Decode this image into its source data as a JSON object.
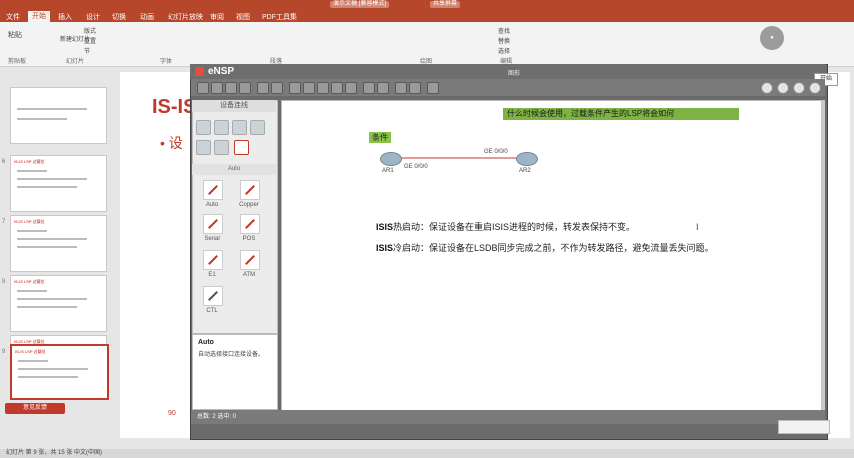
{
  "ppt": {
    "title_btn1": "演示文稿 [兼容模式]",
    "title_btn2": "共享屏幕",
    "tabs": [
      "文件",
      "开始",
      "插入",
      "设计",
      "切换",
      "动画",
      "幻灯片放映",
      "审阅",
      "视图",
      "PDF工具集"
    ],
    "active_tab": "开始",
    "ribbon_groups": [
      "剪贴板",
      "幻灯片",
      "字体",
      "段落",
      "绘图",
      "编辑"
    ],
    "ribbon_items": [
      "粘贴",
      "新建幻灯片",
      "版式",
      "重置",
      "节",
      "查找",
      "替换",
      "选择"
    ],
    "status": "幻灯片 第 9 张，共 15 张  中文(中国)"
  },
  "thumbs": {
    "numbers": [
      "6",
      "7",
      "8",
      "9"
    ],
    "labels": [
      "IS-IS LSP 过载位",
      "IS-IS LSP 过载位",
      "IS-IS LSP 过载位",
      "IS-IS LSP 过载位",
      "IS-IS LSP 过载位"
    ],
    "feedback": "意见反馈"
  },
  "slide": {
    "title": "IS-IS",
    "bullet": "• 设",
    "page_num": "90"
  },
  "ensp": {
    "title": "eNSP",
    "menu_btn": "菜单",
    "subtitle": "图形",
    "device_header": "设备连线",
    "auto_header": "Auto",
    "cables": [
      "Auto",
      "Copper",
      "Serial",
      "POS",
      "E1",
      "ATM",
      "CTL"
    ],
    "info_title": "Auto",
    "info_desc": "自动选择接口连接设备。",
    "statusbar": "总数: 2  选中: 0"
  },
  "canvas": {
    "banner": "什么时候会使用，过载条件产生的LSP将会如何",
    "label_box": "条件",
    "routers": [
      "AR1",
      "AR2"
    ],
    "links": [
      "GE 0/0/0",
      "GE 0/0/0"
    ],
    "note1_head": "ISIS",
    "note1": "热启动：保证设备在重启ISIS进程的时候，转发表保持不变。",
    "note2_head": "ISIS",
    "note2": "冷启动：保证设备在LSDB同步完成之前，不作为转发路径，避免流量丢失问题。",
    "cursor": "I"
  },
  "right_panel": {
    "button": "开始"
  },
  "colors": {
    "ppt_red": "#b7472a",
    "banner_green": "#7cb342",
    "link_red": "#c0392b"
  }
}
